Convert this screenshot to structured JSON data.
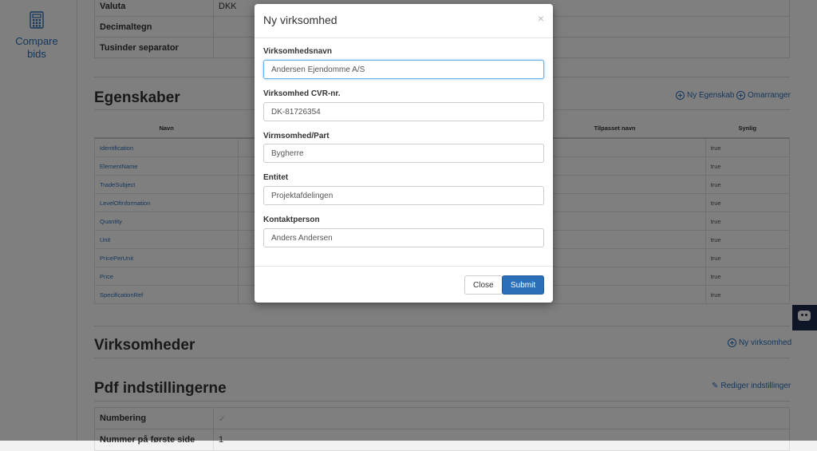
{
  "sidebar": {
    "compare_label_1": "Compare",
    "compare_label_2": "bids"
  },
  "settings": [
    {
      "key": "Valuta",
      "value": "DKK"
    },
    {
      "key": "Decimaltegn",
      "value": ""
    },
    {
      "key": "Tusinder separator",
      "value": ""
    }
  ],
  "egenskaber": {
    "title": "Egenskaber",
    "new_label": "Ny Egenskab",
    "rearrange_label": "Omarranger",
    "headers": {
      "navn": "Navn",
      "tilpasset": "Tilpasset navn",
      "synlig": "Synlig"
    },
    "rows": [
      {
        "name": "Identification",
        "visible": "true"
      },
      {
        "name": "ElementName",
        "visible": "true"
      },
      {
        "name": "TradeSubject",
        "visible": "true"
      },
      {
        "name": "LevelOfInformation",
        "visible": "true"
      },
      {
        "name": "Quantity",
        "visible": "true"
      },
      {
        "name": "Unit",
        "visible": "true"
      },
      {
        "name": "PricePerUnit",
        "visible": "true"
      },
      {
        "name": "Price",
        "visible": "true"
      },
      {
        "name": "SpecificationRef",
        "visible": "true"
      }
    ]
  },
  "virksomheder": {
    "title": "Virksomheder",
    "new_label": "Ny virksomhed"
  },
  "pdf": {
    "title": "Pdf indstillingerne",
    "edit_label": "Rediger indstillinger",
    "rows": [
      {
        "key": "Numbering",
        "value": "✓"
      },
      {
        "key": "Nummer på første side",
        "value": "1"
      }
    ]
  },
  "modal": {
    "title": "Ny virksomhed",
    "close_symbol": "×",
    "fields": [
      {
        "label": "Virksomhedsnavn",
        "value": "Andersen Ejendomme A/S"
      },
      {
        "label": "Virksomhed CVR-nr.",
        "value": "DK-81726354"
      },
      {
        "label": "Virmsomhed/Part",
        "value": "Bygherre"
      },
      {
        "label": "Entitet",
        "value": "Projektafdelingen"
      },
      {
        "label": "Kontaktperson",
        "value": "Anders Andersen"
      }
    ],
    "close_button": "Close",
    "submit_button": "Submit"
  },
  "colors": {
    "accent": "#2a6fb8",
    "chat_bg": "#1c2a4d"
  }
}
